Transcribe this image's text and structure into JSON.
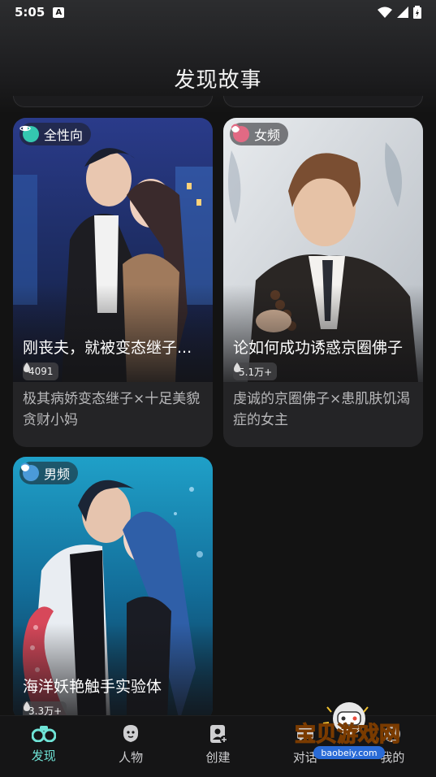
{
  "status_bar": {
    "time": "5:05",
    "notification_icon": "A"
  },
  "page_title": "发现故事",
  "cards": [
    {
      "tag": "全性向",
      "tag_color": "#34c7b0",
      "title": "刚丧夫，就被变态继子...",
      "hot": "4091",
      "desc": "极其病娇变态继子×十足美貌贪财小妈"
    },
    {
      "tag": "女频",
      "tag_color": "#e26a84",
      "title": "论如何成功诱惑京圈佛子",
      "hot": "5.1万+",
      "desc": "虔诚的京圈佛子×患肌肤饥渴症的女主"
    },
    {
      "tag": "男频",
      "tag_color": "#4b9ad8",
      "title": "海洋妖艳触手实验体",
      "hot": "3.3万+",
      "desc": ""
    }
  ],
  "tabs": [
    {
      "label": "发现",
      "icon": "binoculars-icon",
      "active": true
    },
    {
      "label": "人物",
      "icon": "person-icon",
      "active": false
    },
    {
      "label": "创建",
      "icon": "create-icon",
      "active": false
    },
    {
      "label": "对话",
      "icon": "chat-icon",
      "active": false
    },
    {
      "label": "我的",
      "icon": "profile-icon",
      "active": false
    }
  ],
  "watermark": {
    "text": "宝贝游戏网",
    "url": "baobeiy.com"
  },
  "colors": {
    "background": "#131313",
    "accent": "#6fe3d6",
    "card": "#242426"
  }
}
